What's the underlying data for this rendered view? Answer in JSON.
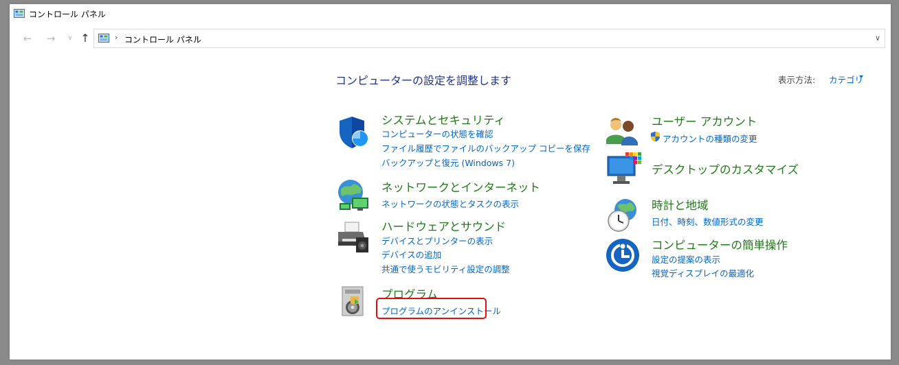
{
  "window": {
    "title": "コントロール パネル"
  },
  "nav": {
    "breadcrumb": "コントロール パネル",
    "separator": "›"
  },
  "content": {
    "heading": "コンピューターの設定を調整します",
    "view_by_label": "表示方法:",
    "view_by_value": "カテゴリ"
  },
  "categories": {
    "system": {
      "title": "システムとセキュリティ",
      "links": [
        "コンピューターの状態を確認",
        "ファイル履歴でファイルのバックアップ コピーを保存",
        "バックアップと復元 (Windows 7)"
      ]
    },
    "network": {
      "title": "ネットワークとインターネット",
      "links": [
        "ネットワークの状態とタスクの表示"
      ]
    },
    "hardware": {
      "title": "ハードウェアとサウンド",
      "links": [
        "デバイスとプリンターの表示",
        "デバイスの追加",
        "共通で使うモビリティ設定の調整"
      ]
    },
    "programs": {
      "title": "プログラム",
      "links": [
        "プログラムのアンインストール"
      ]
    },
    "users": {
      "title": "ユーザー アカウント",
      "links": [
        "アカウントの種類の変更"
      ]
    },
    "appearance": {
      "title": "デスクトップのカスタマイズ",
      "links": []
    },
    "clock": {
      "title": "時計と地域",
      "links": [
        "日付、時刻、数値形式の変更"
      ]
    },
    "ease": {
      "title": "コンピューターの簡単操作",
      "links": [
        "設定の提案の表示",
        "視覚ディスプレイの最適化"
      ]
    }
  },
  "colors": {
    "category_title": "#1e7a16",
    "link": "#0066cc",
    "heading": "#1e3287",
    "highlight": "#e01010"
  },
  "icons": {
    "window": "control-panel-icon",
    "system": "shield-icon",
    "network": "network-globe-icon",
    "hardware": "printer-icon",
    "programs": "program-disc-icon",
    "users": "users-icon",
    "uac": "uac-shield-icon",
    "appearance": "desktop-monitor-icon",
    "clock": "clock-globe-icon",
    "ease": "ease-of-access-icon"
  }
}
